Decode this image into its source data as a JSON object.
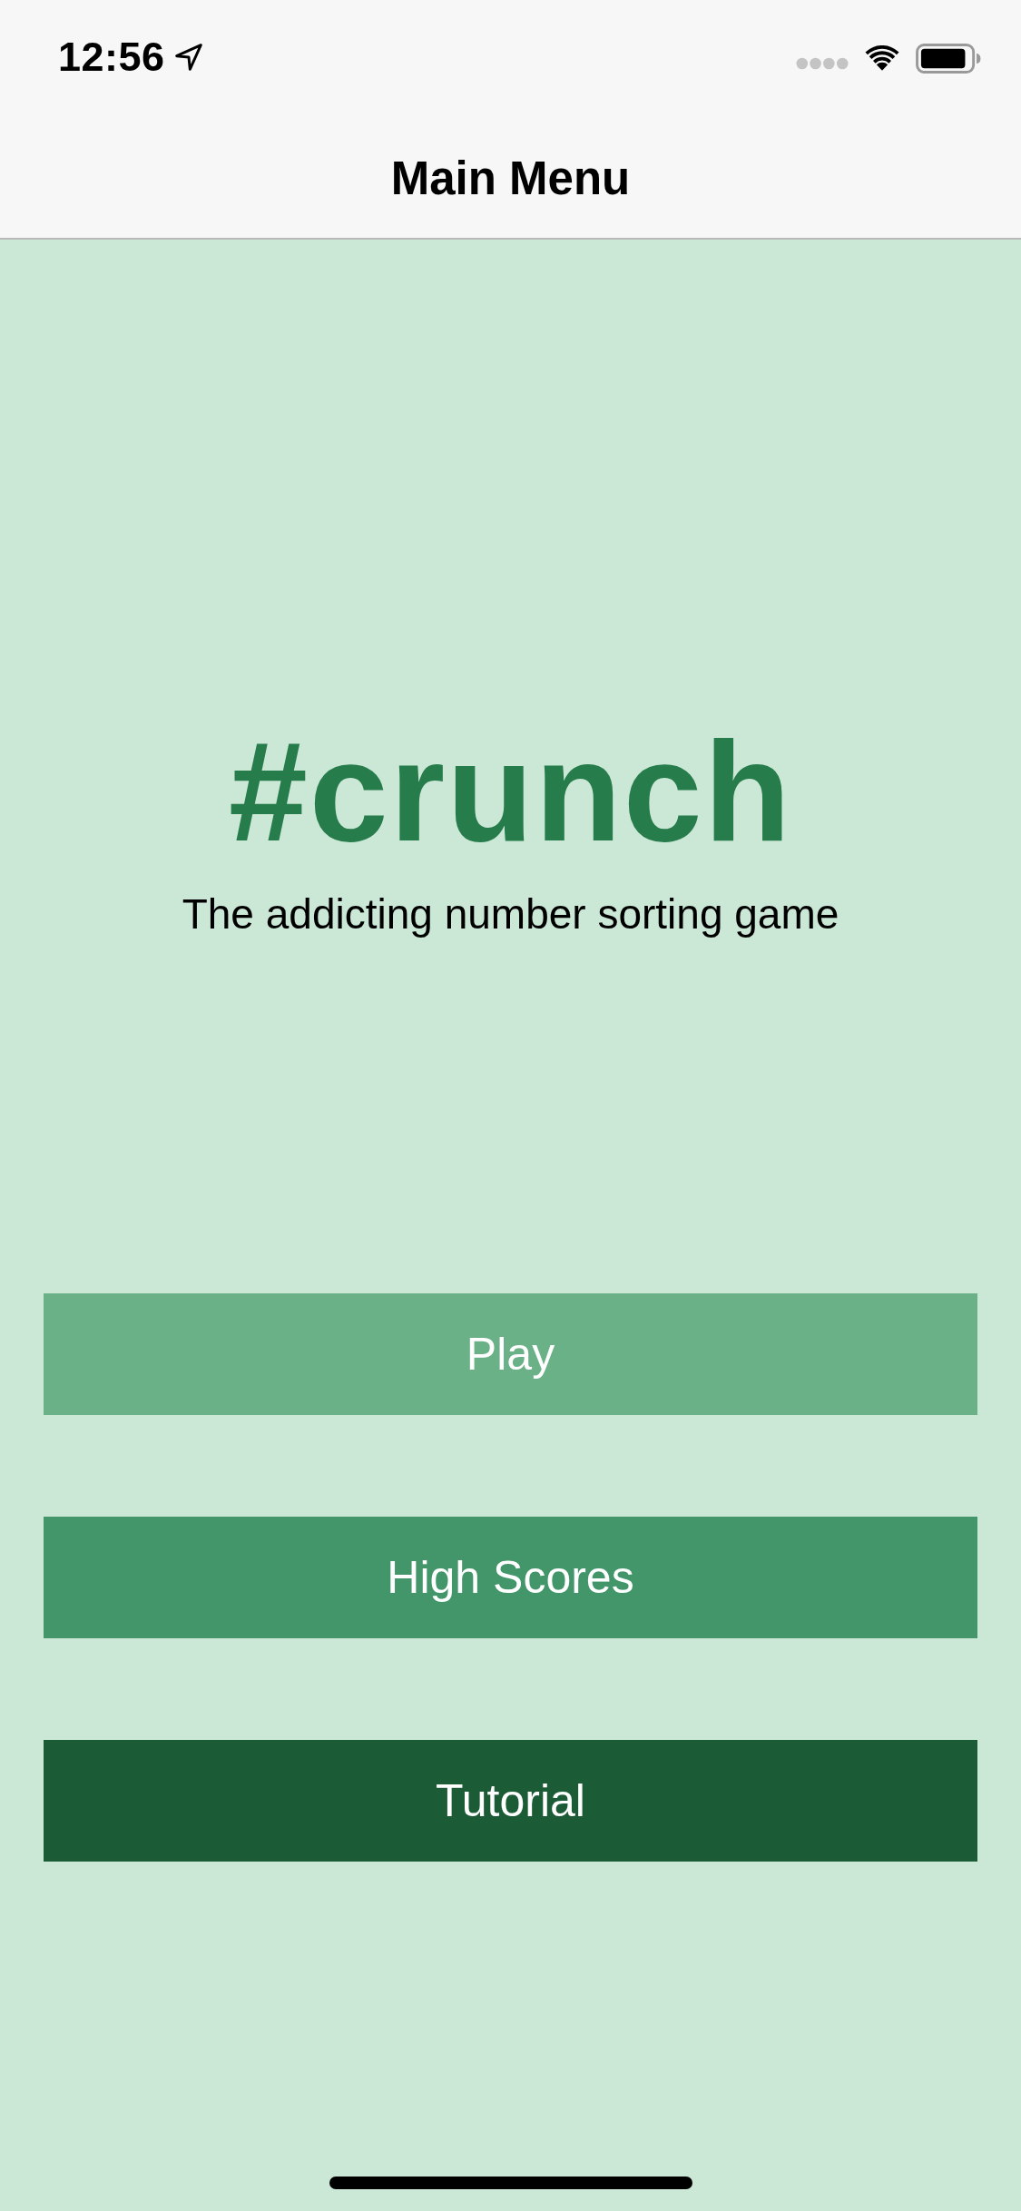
{
  "status_bar": {
    "time": "12:56"
  },
  "nav_bar": {
    "title": "Main Menu"
  },
  "header": {
    "title": "#crunch",
    "subtitle": "The addicting number sorting game"
  },
  "buttons": [
    {
      "label": "Play",
      "color": "#6ab188"
    },
    {
      "label": "High Scores",
      "color": "#42966a"
    },
    {
      "label": "Tutorial",
      "color": "#1b5b35"
    }
  ]
}
